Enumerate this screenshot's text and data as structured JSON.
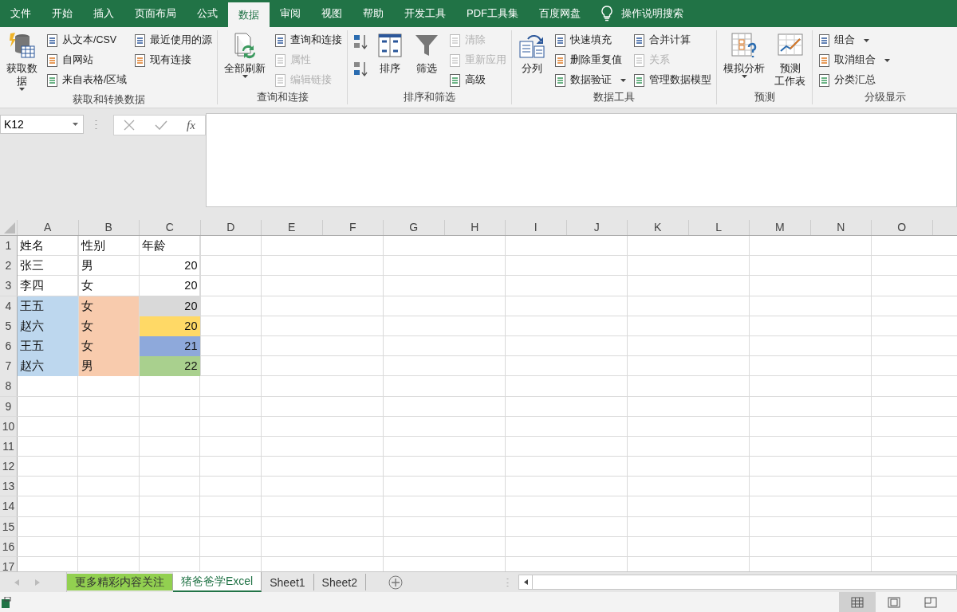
{
  "menu_tabs": [
    {
      "label": "文件",
      "selected": false
    },
    {
      "label": "开始",
      "selected": false
    },
    {
      "label": "插入",
      "selected": false
    },
    {
      "label": "页面布局",
      "selected": false
    },
    {
      "label": "公式",
      "selected": false
    },
    {
      "label": "数据",
      "selected": true
    },
    {
      "label": "审阅",
      "selected": false
    },
    {
      "label": "视图",
      "selected": false
    },
    {
      "label": "帮助",
      "selected": false
    },
    {
      "label": "开发工具",
      "selected": false
    },
    {
      "label": "PDF工具集",
      "selected": false
    },
    {
      "label": "百度网盘",
      "selected": false
    }
  ],
  "tell_me": {
    "placeholder": "操作说明搜索"
  },
  "ribbon_groups": [
    {
      "label": "获取和转换数据",
      "controls": [
        {
          "kind": "large",
          "lines": [
            "获取数",
            "据"
          ],
          "dropdown": true
        },
        {
          "kind": "column",
          "items": [
            {
              "label": "从文本/CSV",
              "disabled": false,
              "dropdown": false
            },
            {
              "label": "自网站",
              "disabled": false,
              "dropdown": false
            },
            {
              "label": "来自表格/区域",
              "disabled": false,
              "dropdown": false
            }
          ]
        },
        {
          "kind": "column",
          "items": [
            {
              "label": "最近使用的源",
              "disabled": false,
              "dropdown": false
            },
            {
              "label": "现有连接",
              "disabled": false,
              "dropdown": false
            }
          ]
        }
      ]
    },
    {
      "label": "查询和连接",
      "controls": [
        {
          "kind": "large",
          "lines": [
            "全部刷新"
          ],
          "dropdown": true
        },
        {
          "kind": "column",
          "items": [
            {
              "label": "查询和连接",
              "disabled": false,
              "dropdown": false
            },
            {
              "label": "属性",
              "disabled": true,
              "dropdown": false
            },
            {
              "label": "编辑链接",
              "disabled": true,
              "dropdown": false
            }
          ]
        }
      ]
    },
    {
      "label": "排序和筛选",
      "controls": [
        {
          "kind": "sort-buttons"
        },
        {
          "kind": "large",
          "lines": [
            "排序"
          ],
          "dropdown": false
        },
        {
          "kind": "large",
          "lines": [
            "筛选"
          ],
          "dropdown": false
        },
        {
          "kind": "column",
          "items": [
            {
              "label": "清除",
              "disabled": true,
              "dropdown": false
            },
            {
              "label": "重新应用",
              "disabled": true,
              "dropdown": false
            },
            {
              "label": "高级",
              "disabled": false,
              "dropdown": false
            }
          ]
        }
      ]
    },
    {
      "label": "数据工具",
      "controls": [
        {
          "kind": "large",
          "lines": [
            "分列"
          ],
          "dropdown": false
        },
        {
          "kind": "column",
          "items": [
            {
              "label": "快速填充",
              "disabled": false,
              "dropdown": false
            },
            {
              "label": "删除重复值",
              "disabled": false,
              "dropdown": false
            },
            {
              "label": "数据验证",
              "disabled": false,
              "dropdown": true
            }
          ]
        },
        {
          "kind": "column",
          "items": [
            {
              "label": "合并计算",
              "disabled": false,
              "dropdown": false
            },
            {
              "label": "关系",
              "disabled": true,
              "dropdown": false
            },
            {
              "label": "管理数据模型",
              "disabled": false,
              "dropdown": false
            }
          ]
        }
      ]
    },
    {
      "label": "预测",
      "controls": [
        {
          "kind": "large",
          "lines": [
            "模拟分析"
          ],
          "dropdown": true
        },
        {
          "kind": "large",
          "lines": [
            "预测",
            "工作表"
          ],
          "dropdown": false
        }
      ]
    },
    {
      "label": "分级显示",
      "controls": [
        {
          "kind": "column",
          "items": [
            {
              "label": "组合",
              "disabled": false,
              "dropdown": true
            },
            {
              "label": "取消组合",
              "disabled": false,
              "dropdown": true
            },
            {
              "label": "分类汇总",
              "disabled": false,
              "dropdown": false
            }
          ]
        }
      ]
    }
  ],
  "name_box": {
    "value": "K12"
  },
  "formula_bar": {
    "function_label": "fx"
  },
  "columns": [
    "A",
    "B",
    "C",
    "D",
    "E",
    "F",
    "G",
    "H",
    "I",
    "J",
    "K",
    "L",
    "M",
    "N",
    "O"
  ],
  "rows": [
    {
      "number": "1",
      "cells": [
        {
          "value": "姓名",
          "kind": "text"
        },
        {
          "value": "性别",
          "kind": "text"
        },
        {
          "value": "年龄",
          "kind": "text"
        }
      ]
    },
    {
      "number": "2",
      "cells": [
        {
          "value": "张三",
          "kind": "text"
        },
        {
          "value": "男",
          "kind": "text"
        },
        {
          "value": "20",
          "kind": "number"
        }
      ]
    },
    {
      "number": "3",
      "cells": [
        {
          "value": "李四",
          "kind": "text"
        },
        {
          "value": "女",
          "kind": "text"
        },
        {
          "value": "20",
          "kind": "number"
        }
      ]
    },
    {
      "number": "4",
      "cells": [
        {
          "value": "王五",
          "kind": "text",
          "color": "#bdd7ee"
        },
        {
          "value": "女",
          "kind": "text",
          "color": "#f8cbad"
        },
        {
          "value": "20",
          "kind": "number",
          "color": "#d9d9d9"
        }
      ]
    },
    {
      "number": "5",
      "cells": [
        {
          "value": "赵六",
          "kind": "text",
          "color": "#bdd7ee"
        },
        {
          "value": "女",
          "kind": "text",
          "color": "#f8cbad"
        },
        {
          "value": "20",
          "kind": "number",
          "color": "#ffd966"
        }
      ]
    },
    {
      "number": "6",
      "cells": [
        {
          "value": "王五",
          "kind": "text",
          "color": "#bdd7ee"
        },
        {
          "value": "女",
          "kind": "text",
          "color": "#f8cbad"
        },
        {
          "value": "21",
          "kind": "number",
          "color": "#8ea9db"
        }
      ]
    },
    {
      "number": "7",
      "cells": [
        {
          "value": "赵六",
          "kind": "text",
          "color": "#bdd7ee"
        },
        {
          "value": "男",
          "kind": "text",
          "color": "#f8cbad"
        },
        {
          "value": "22",
          "kind": "number",
          "color": "#a9d08e"
        }
      ]
    },
    {
      "number": "8",
      "cells": []
    },
    {
      "number": "9",
      "cells": []
    },
    {
      "number": "10",
      "cells": []
    },
    {
      "number": "11",
      "cells": []
    },
    {
      "number": "12",
      "cells": []
    },
    {
      "number": "13",
      "cells": []
    },
    {
      "number": "14",
      "cells": []
    },
    {
      "number": "15",
      "cells": []
    },
    {
      "number": "16",
      "cells": []
    },
    {
      "number": "17",
      "cells": []
    }
  ],
  "sheet_tabs": [
    {
      "label": "更多精彩内容关注",
      "selected": false,
      "color": "#92d050"
    },
    {
      "label": "猪爸爸学Excel",
      "selected": true
    },
    {
      "label": "Sheet1",
      "selected": false
    },
    {
      "label": "Sheet2",
      "selected": false
    }
  ],
  "view_buttons": [
    {
      "selected": true
    },
    {
      "selected": false
    },
    {
      "selected": false
    }
  ]
}
